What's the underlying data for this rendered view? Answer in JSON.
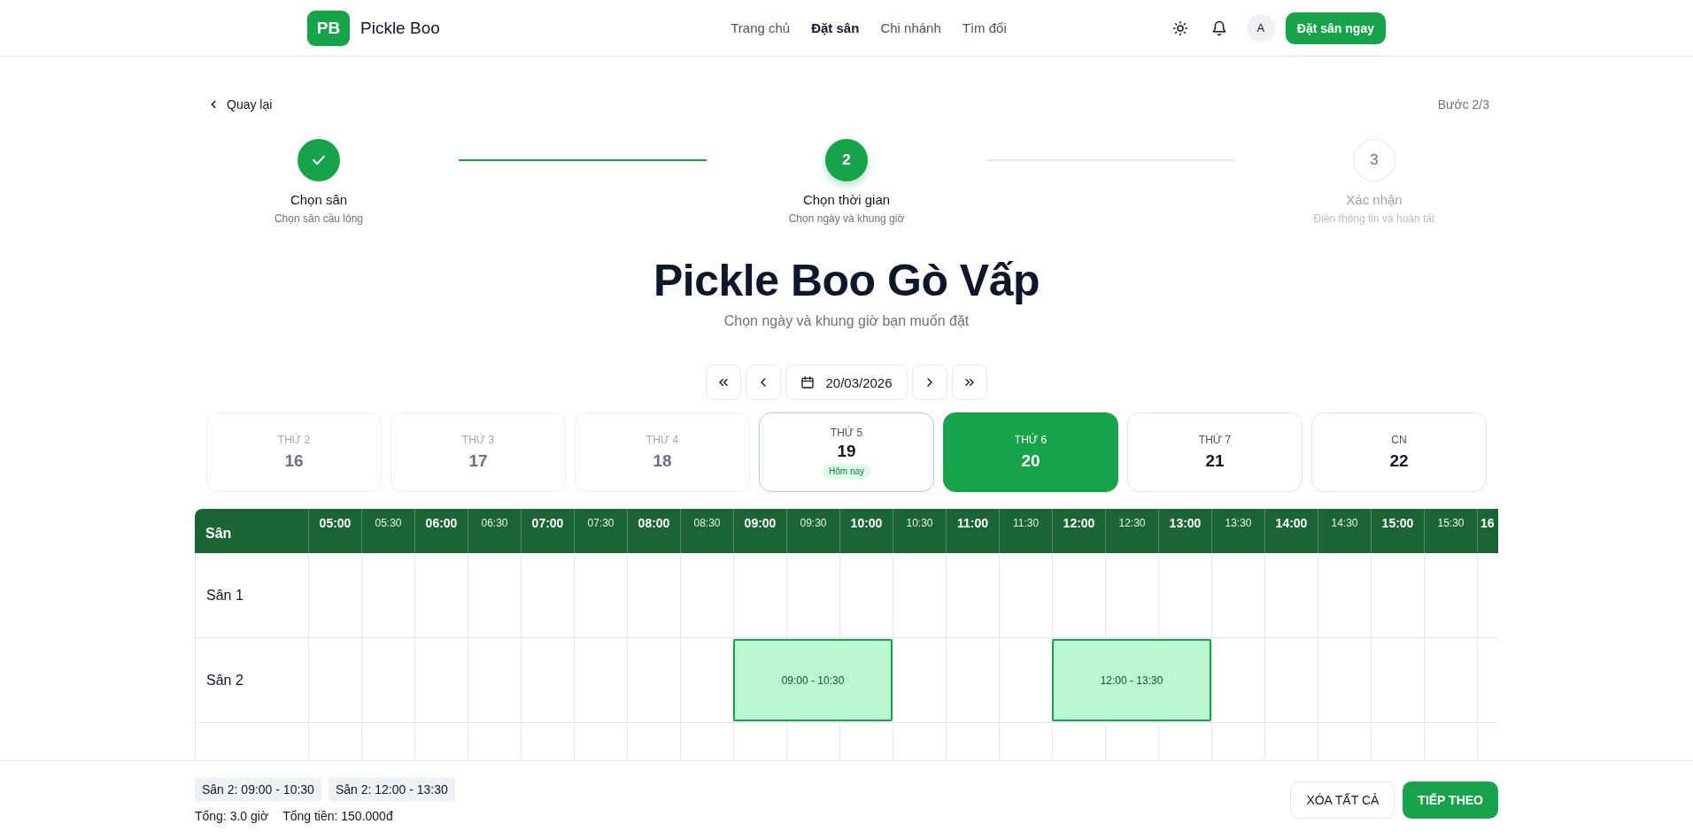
{
  "header": {
    "logo_mark": "PB",
    "brand": "Pickle Boo",
    "nav": [
      {
        "label": "Trang chủ",
        "selected": false
      },
      {
        "label": "Đặt sân",
        "selected": true
      },
      {
        "label": "Chi nhánh",
        "selected": false
      },
      {
        "label": "Tìm đối",
        "selected": false
      }
    ],
    "avatar": "A",
    "cta": "Đặt sân ngay"
  },
  "back": "Quay lại",
  "step_counter": "Bước 2/3",
  "steps": [
    {
      "completed": true,
      "selected": false,
      "title": "Chọn sân",
      "subtitle": "Chọn sân cầu lông"
    },
    {
      "completed": false,
      "selected": true,
      "number": "2",
      "title": "Chọn thời gian",
      "subtitle": "Chọn ngày và khung giờ"
    },
    {
      "completed": false,
      "selected": false,
      "number": "3",
      "title": "Xác nhận",
      "subtitle": "Điền thông tin và hoàn tất"
    }
  ],
  "venue": {
    "title": "Pickle Boo Gò Vấp",
    "subtitle": "Chọn ngày và khung giờ bạn muốn đặt"
  },
  "date_nav": {
    "date": "20/03/2026"
  },
  "days": [
    {
      "weekday": "THỨ 2",
      "day": "16",
      "past": true,
      "today": false,
      "selected": false
    },
    {
      "weekday": "THỨ 3",
      "day": "17",
      "past": true,
      "today": false,
      "selected": false
    },
    {
      "weekday": "THỨ 4",
      "day": "18",
      "past": true,
      "today": false,
      "selected": false
    },
    {
      "weekday": "THỨ 5",
      "day": "19",
      "past": false,
      "today": true,
      "badge": "Hôm nay",
      "selected": false
    },
    {
      "weekday": "THỨ 6",
      "day": "20",
      "past": false,
      "today": false,
      "selected": true
    },
    {
      "weekday": "THỨ 7",
      "day": "21",
      "past": false,
      "today": false,
      "selected": false
    },
    {
      "weekday": "CN",
      "day": "22",
      "past": false,
      "today": false,
      "selected": false
    }
  ],
  "schedule": {
    "corner": "Sân",
    "slots": [
      {
        "label": "05:00",
        "kind": "hour"
      },
      {
        "label": "05:30",
        "kind": "half"
      },
      {
        "label": "06:00",
        "kind": "hour"
      },
      {
        "label": "06:30",
        "kind": "half"
      },
      {
        "label": "07:00",
        "kind": "hour"
      },
      {
        "label": "07:30",
        "kind": "half"
      },
      {
        "label": "08:00",
        "kind": "hour"
      },
      {
        "label": "08:30",
        "kind": "half"
      },
      {
        "label": "09:00",
        "kind": "hour"
      },
      {
        "label": "09:30",
        "kind": "half"
      },
      {
        "label": "10:00",
        "kind": "hour"
      },
      {
        "label": "10:30",
        "kind": "half"
      },
      {
        "label": "11:00",
        "kind": "hour"
      },
      {
        "label": "11:30",
        "kind": "half"
      },
      {
        "label": "12:00",
        "kind": "hour"
      },
      {
        "label": "12:30",
        "kind": "half"
      },
      {
        "label": "13:00",
        "kind": "hour"
      },
      {
        "label": "13:30",
        "kind": "half"
      },
      {
        "label": "14:00",
        "kind": "hour"
      },
      {
        "label": "14:30",
        "kind": "half"
      },
      {
        "label": "15:00",
        "kind": "hour"
      },
      {
        "label": "15:30",
        "kind": "half"
      },
      {
        "label": "16",
        "kind": "cut"
      }
    ],
    "courts": [
      {
        "name": "Sân 1"
      },
      {
        "name": "Sân 2",
        "bookings": [
          {
            "label": "09:00 - 10:30"
          },
          {
            "label": "12:00 - 13:30"
          }
        ]
      }
    ]
  },
  "footer": {
    "selections": [
      "Sân 2: 09:00 - 10:30",
      "Sân 2: 12:00 - 13:30"
    ],
    "total_hours": "Tổng: 3.0 giờ",
    "total_price": "Tổng tiền: 150.000đ",
    "clear_button": "XÓA TẤT CẢ",
    "next_button": "TIẾP THEO"
  }
}
